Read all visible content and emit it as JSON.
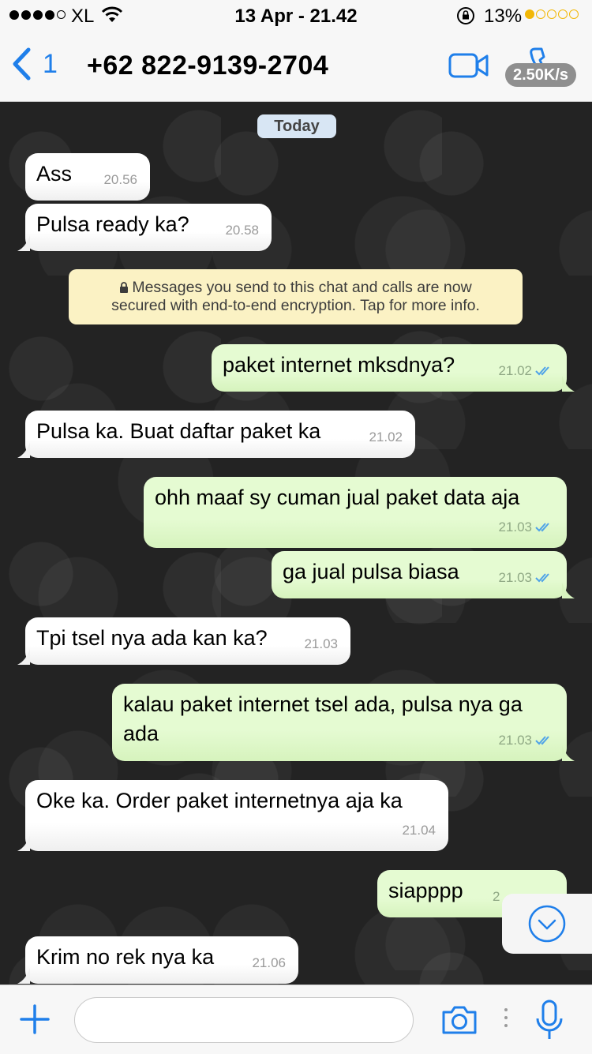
{
  "status_bar": {
    "carrier": "XL",
    "time": "13 Apr - 21.42",
    "battery": "13%"
  },
  "nav": {
    "back_count": "1",
    "contact": "+62 822-9139-2704",
    "speed": "2.50K/s"
  },
  "chat": {
    "day": "Today",
    "encryption_notice": "Messages you send to this chat and calls are now\nsecured with end-to-end encryption. Tap for more info.",
    "messages": [
      {
        "dir": "in",
        "text": "Ass",
        "time": "20.56"
      },
      {
        "dir": "in",
        "text": "Pulsa ready ka?",
        "time": "20.58"
      },
      {
        "dir": "out",
        "text": "paket internet mksdnya?",
        "time": "21.02"
      },
      {
        "dir": "in",
        "text": "Pulsa ka. Buat daftar paket ka",
        "time": "21.02"
      },
      {
        "dir": "out",
        "text": "ohh maaf sy cuman jual paket data aja",
        "time": "21.03"
      },
      {
        "dir": "out",
        "text": "ga jual pulsa biasa",
        "time": "21.03"
      },
      {
        "dir": "in",
        "text": "Tpi tsel nya ada kan ka?",
        "time": "21.03"
      },
      {
        "dir": "out",
        "text": "kalau paket internet tsel ada, pulsa nya ga ada",
        "time": "21.03"
      },
      {
        "dir": "in",
        "text": "Oke ka. Order paket internetnya aja ka",
        "time": "21.04"
      },
      {
        "dir": "out",
        "text": "siapppp",
        "time": "2"
      },
      {
        "dir": "in",
        "text": "Krim no rek nya ka",
        "time": "21.06"
      }
    ]
  },
  "input": {
    "placeholder": ""
  },
  "colors": {
    "accent": "#1f7fea",
    "bubble_out": "#dcf8c6",
    "bubble_in": "#ffffff",
    "notice": "#fbf2c4",
    "read_ticks": "#4fa3e8"
  }
}
